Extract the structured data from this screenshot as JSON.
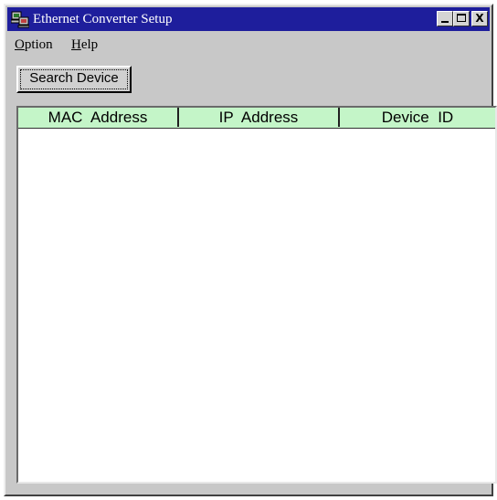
{
  "window": {
    "title": "Ethernet Converter Setup",
    "icon": "network-computer-icon",
    "controls": {
      "minimize": "minimize-icon",
      "maximize": "maximize-icon",
      "close_label": "X"
    }
  },
  "menu": {
    "option_mnemonic": "O",
    "option_rest": "ption",
    "help_mnemonic": "H",
    "help_rest": "elp"
  },
  "toolbar": {
    "search_label": "Search Device"
  },
  "table": {
    "columns": [
      "MAC  Address",
      "IP  Address",
      "Device  ID"
    ],
    "rows": []
  },
  "colors": {
    "titlebar": "#1e1e9c",
    "header_bg": "#c4f5c8",
    "window_bg": "#c8c8c8"
  }
}
